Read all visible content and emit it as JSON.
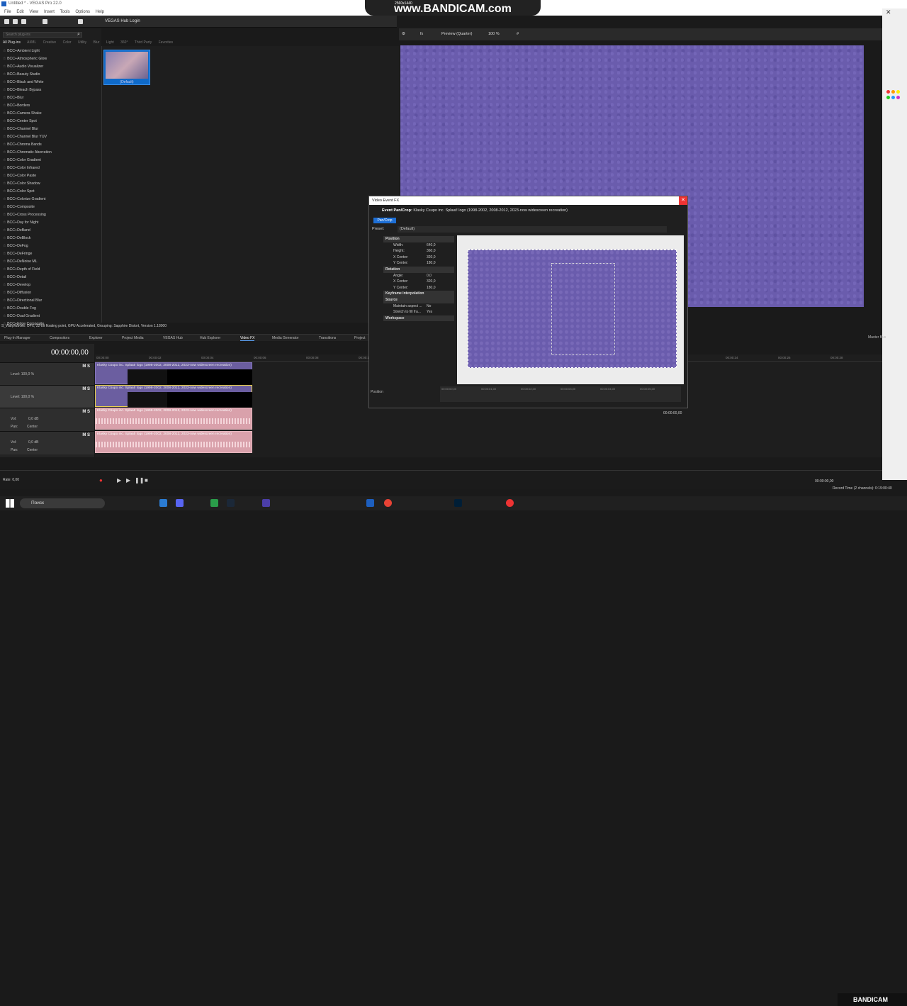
{
  "window": {
    "title": "Untitled * - VEGAS Pro 22.0"
  },
  "menu": [
    "File",
    "Edit",
    "View",
    "Insert",
    "Tools",
    "Options",
    "Help"
  ],
  "bandicam": {
    "watermark": "www.BANDICAM.com",
    "resolution": "2560x1440"
  },
  "toolbar": {
    "hub_login": "VEGAS Hub Login"
  },
  "plugins": {
    "search_placeholder": "Search plug-ins",
    "tabs": [
      "All Plug-ins",
      "AI/ML",
      "Creative",
      "Color",
      "Utility",
      "Blur",
      "Light",
      "360°",
      "Third Party",
      "Favorites"
    ],
    "items": [
      "BCC+Ambient Light",
      "BCC+Atmospheric Glow",
      "BCC+Audio Visualizer",
      "BCC+Beauty Studio",
      "BCC+Black and White",
      "BCC+Bleach Bypass",
      "BCC+Blur",
      "BCC+Borders",
      "BCC+Camera Shake",
      "BCC+Center Spot",
      "BCC+Channel Blur",
      "BCC+Channel Blur YUV",
      "BCC+Chroma Bands",
      "BCC+Chromatic Aberration",
      "BCC+Color Gradient",
      "BCC+Color Infrared",
      "BCC+Color Paste",
      "BCC+Color Shadow",
      "BCC+Color Spot",
      "BCC+Colorize Gradient",
      "BCC+Composite",
      "BCC+Cross Processing",
      "BCC+Day for Night",
      "BCC+DeBand",
      "BCC+DeBlock",
      "BCC+DeFog",
      "BCC+DeFringe",
      "BCC+DeNoise ML",
      "BCC+Depth of Field",
      "BCC+Detail",
      "BCC+Develop",
      "BCC+Diffusion",
      "BCC+Directional Blur",
      "BCC+Double Fog",
      "BCC+Dual Gradient",
      "BCC+Edge Composite"
    ],
    "preset_thumb": "(Default)",
    "status": "S_WarpWaves: OFX, 32-bit floating point, GPU Accelerated, Grouping: Sapphire Distort, Version 1.18000"
  },
  "preview": {
    "mode": "Preview (Quarter)",
    "zoom": "100 %"
  },
  "fx": {
    "title": "Video Event FX",
    "header_label": "Event Pan/Crop:",
    "header_event": "Klasky Csupo inc. Splaat! logo (1998-2002, 2008-2012, 2023-now widescreen recreation)",
    "tab": "Pan/Crop",
    "preset_label": "Preset:",
    "preset_value": "(Default)",
    "sections": {
      "position": "Position",
      "rotation": "Rotation",
      "keyframe": "Keyframe interpolation",
      "source": "Source",
      "workspace": "Workspace"
    },
    "rows": {
      "width": {
        "label": "Width:",
        "value": "640,0"
      },
      "height": {
        "label": "Height:",
        "value": "360,0"
      },
      "xcenter": {
        "label": "X Center:",
        "value": "320,0"
      },
      "ycenter": {
        "label": "Y Center:",
        "value": "180,0"
      },
      "angle": {
        "label": "Angle:",
        "value": "0,0"
      },
      "rxcenter": {
        "label": "X Center:",
        "value": "320,0"
      },
      "rycenter": {
        "label": "Y Center:",
        "value": "180,0"
      },
      "aspect": {
        "label": "Maintain aspect ...",
        "value": "No"
      },
      "stretch": {
        "label": "Stretch to fill fra...",
        "value": "Yes"
      }
    },
    "tl_position": "Position",
    "tl_time": "00:00:00,00",
    "tl_ticks": [
      "00:00:00,00",
      "00:00:01,00",
      "00:00:02,00",
      "00:00:03,00",
      "00:00:04,00",
      "00:00:05,00"
    ]
  },
  "lower_tabs": [
    "Plug-In Manager",
    "Compositors",
    "Explorer",
    "Project Media",
    "VEGAS Hub",
    "Hub Explorer",
    "Video FX",
    "Media Generator",
    "Transitions",
    "Project"
  ],
  "timeline": {
    "timecode": "00:00:00,00",
    "ruler": [
      "00:00:00",
      "00:00:02",
      "00:00:04",
      "00:00:06",
      "00:00:08",
      "00:00:10",
      "00:00:12",
      "00:00:14",
      "00:00:16",
      "00:00:18",
      "00:00:20",
      "00:00:22",
      "00:00:24",
      "00:00:26",
      "00:00:28"
    ],
    "video_tracks": [
      {
        "ms": "M S",
        "level": "Level: 100,0 %"
      },
      {
        "ms": "M S",
        "level": "Level: 100,0 %"
      }
    ],
    "audio_tracks": [
      {
        "ms": "M S",
        "vol": "Vol:",
        "vol_value": "0,0 dB",
        "pan": "Pan:",
        "pan_value": "Center"
      },
      {
        "ms": "M S",
        "vol": "Vol:",
        "vol_value": "0,0 dB",
        "pan": "Pan:",
        "pan_value": "Center"
      }
    ],
    "clip_name": "Klasky Csupo inc. Splaat! logo (1998-2002, 2008-2012, 2023-now widescreen recreation)",
    "master_bus": "Master Bus"
  },
  "transport": {
    "rate": "Rate: 0,00",
    "time": "00:00:00,00",
    "record_time": "Record Time (2 channels): 0:19:00:40"
  },
  "taskbar": {
    "search": "Поиск",
    "bandicam": "BANDICAM"
  }
}
